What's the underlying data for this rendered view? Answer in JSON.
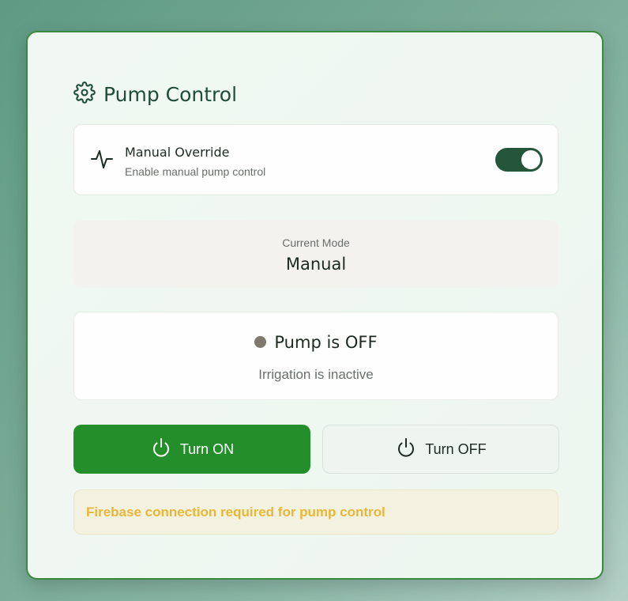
{
  "header": {
    "title": "Pump Control",
    "icon": "gear-icon"
  },
  "override": {
    "icon": "pulse-icon",
    "title": "Manual Override",
    "subtitle": "Enable manual pump control",
    "enabled": true
  },
  "mode": {
    "label": "Current Mode",
    "value": "Manual"
  },
  "status": {
    "indicator_color": "#7f786c",
    "title": "Pump is OFF",
    "subtitle": "Irrigation is inactive"
  },
  "buttons": {
    "on_label": "Turn ON",
    "off_label": "Turn OFF",
    "on_color": "#248f2a",
    "icon": "power-icon"
  },
  "warning": {
    "text": "Firebase connection required for pump control",
    "color": "#e8b73a"
  },
  "colors": {
    "accent": "#24563c",
    "border": "#3a8a3e"
  }
}
